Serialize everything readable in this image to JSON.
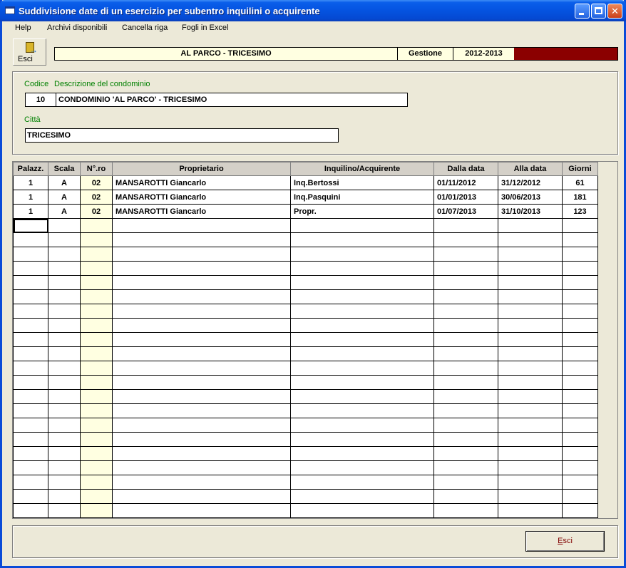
{
  "window": {
    "title": "Suddivisione date di un esercizio per subentro inquilini o acquirente"
  },
  "menu": [
    "Help",
    "Archivi disponibili",
    "Cancella riga",
    "Fogli in Excel"
  ],
  "toolbar": {
    "exit_label": "Esci",
    "exit_icon": "exit-door-icon"
  },
  "header": {
    "condominio": "AL PARCO - TRICESIMO",
    "gestione_label": "Gestione",
    "gestione_value": "2012-2013",
    "status_color": "#8B0000"
  },
  "condominio": {
    "codice_label": "Codice",
    "descrizione_label": "Descrizione del condominio",
    "codice": "10",
    "descrizione": "CONDOMINIO 'AL PARCO' - TRICESIMO",
    "citta_label": "Città",
    "citta": "TRICESIMO"
  },
  "grid": {
    "columns": [
      "Palazz.",
      "Scala",
      "N°.ro",
      "Proprietario",
      "Inquilino/Acquirente",
      "Dalla data",
      "Alla data",
      "Giorni"
    ],
    "rows": [
      [
        "1",
        "A",
        "02",
        "MANSAROTTI Giancarlo",
        "Inq.Bertossi",
        "01/11/2012",
        "31/12/2012",
        "61"
      ],
      [
        "1",
        "A",
        "02",
        "MANSAROTTI Giancarlo",
        "Inq.Pasquini",
        "01/01/2013",
        "30/06/2013",
        "181"
      ],
      [
        "1",
        "A",
        "02",
        "MANSAROTTI Giancarlo",
        "Propr.",
        "01/07/2013",
        "31/10/2013",
        "123"
      ]
    ]
  },
  "footer": {
    "exit_prefix": "E",
    "exit_rest": "sci"
  }
}
